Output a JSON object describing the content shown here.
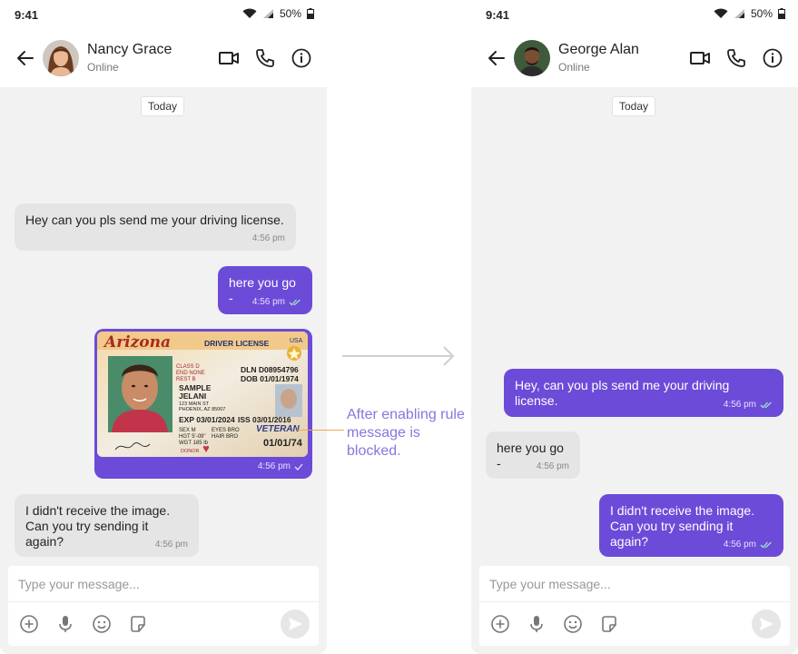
{
  "left": {
    "status": {
      "time": "9:41",
      "battery": "50%"
    },
    "header": {
      "name": "Nancy Grace",
      "status": "Online"
    },
    "date_chip": "Today",
    "messages": [
      {
        "text": "Hey  can you pls send me your driving license.",
        "time": "4:56 pm"
      },
      {
        "text": "here you go -",
        "time": "4:56 pm"
      },
      {
        "time": "4:56 pm"
      },
      {
        "text": "I didn't receive the image.\nCan you try sending it again?",
        "time": "4:56 pm"
      }
    ],
    "license": {
      "state": "Arizona",
      "title": "DRIVER LICENSE",
      "country": "USA",
      "class": "CLASS D",
      "end": "END  NONE",
      "rest": "REST B",
      "dln": "DLN D08954796",
      "dob": "DOB 01/01/1974",
      "name1": "SAMPLE",
      "name2": "JELANI",
      "addr1": "123 MAIN ST",
      "addr2": "PHOENIX, AZ 85007",
      "exp": "EXP 03/01/2024",
      "iss": "ISS 03/01/2016",
      "sex": "SEX  M",
      "eyes": "EYES BRO",
      "hgt": "HGT 5'-09\"",
      "hair": "HAIR BRO",
      "wgt": "WGT 185 lb",
      "veteran": "VETERAN",
      "donor": "DONOR",
      "dob_big": "01/01/74"
    },
    "composer": {
      "placeholder": "Type your message..."
    }
  },
  "right": {
    "status": {
      "time": "9:41",
      "battery": "50%"
    },
    "header": {
      "name": "George Alan",
      "status": "Online"
    },
    "date_chip": "Today",
    "messages": [
      {
        "text": "Hey, can you pls send me your driving license.",
        "time": "4:56 pm"
      },
      {
        "text": "here you go -",
        "time": "4:56 pm"
      },
      {
        "text": "I didn't receive the image.\nCan you try sending it again?",
        "time": "4:56 pm"
      }
    ],
    "composer": {
      "placeholder": "Type your message..."
    }
  },
  "annotation": "After enabling rule message is blocked.",
  "colors": {
    "accent": "#6c4bd8",
    "annotation": "#8b74dd",
    "incoming": "#e5e5e5",
    "annotation_line": "#f0a64a"
  }
}
